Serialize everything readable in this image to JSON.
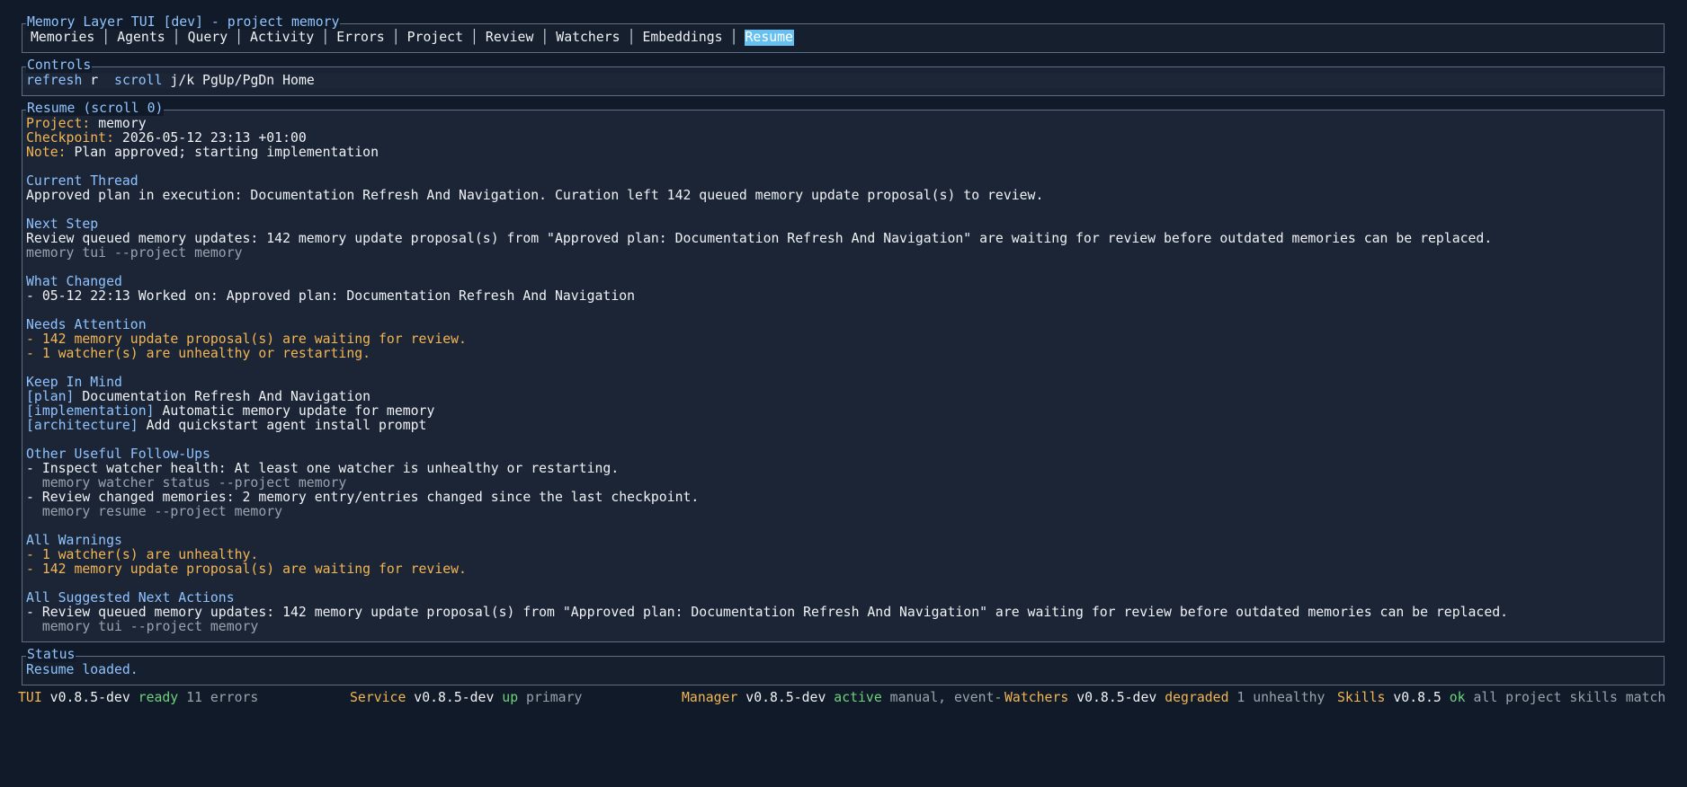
{
  "window": {
    "title": "Memory Layer TUI [dev] - project memory"
  },
  "tabs": [
    {
      "label": "Memories",
      "active": false
    },
    {
      "label": "Agents",
      "active": false
    },
    {
      "label": "Query",
      "active": false
    },
    {
      "label": "Activity",
      "active": false
    },
    {
      "label": "Errors",
      "active": false
    },
    {
      "label": "Project",
      "active": false
    },
    {
      "label": "Review",
      "active": false
    },
    {
      "label": "Watchers",
      "active": false
    },
    {
      "label": "Embeddings",
      "active": false
    },
    {
      "label": "Resume",
      "active": true
    }
  ],
  "controls": {
    "title": "Controls",
    "refresh_label": "refresh",
    "refresh_key": "r",
    "scroll_label": "scroll",
    "scroll_keys": "j/k PgUp/PgDn Home"
  },
  "resume": {
    "title": "Resume (scroll 0)",
    "project_label": "Project:",
    "project_value": "memory",
    "checkpoint_label": "Checkpoint:",
    "checkpoint_value": "2026-05-12 23:13 +01:00",
    "note_label": "Note:",
    "note_value": "Plan approved; starting implementation",
    "current_thread": {
      "heading": "Current Thread",
      "text": "Approved plan in execution: Documentation Refresh And Navigation. Curation left 142 queued memory update proposal(s) to review."
    },
    "next_step": {
      "heading": "Next Step",
      "text": "Review queued memory updates: 142 memory update proposal(s) from \"Approved plan: Documentation Refresh And Navigation\" are waiting for review before outdated memories can be replaced.",
      "command": "memory tui --project memory"
    },
    "what_changed": {
      "heading": "What Changed",
      "items": [
        "- 05-12 22:13 Worked on: Approved plan: Documentation Refresh And Navigation"
      ]
    },
    "needs_attention": {
      "heading": "Needs Attention",
      "items": [
        "- 142 memory update proposal(s) are waiting for review.",
        "- 1 watcher(s) are unhealthy or restarting."
      ]
    },
    "keep_in_mind": {
      "heading": "Keep In Mind",
      "items": [
        {
          "tag": "[plan]",
          "text": "Documentation Refresh And Navigation"
        },
        {
          "tag": "[implementation]",
          "text": "Automatic memory update for memory"
        },
        {
          "tag": "[architecture]",
          "text": "Add quickstart agent install prompt"
        }
      ]
    },
    "follow_ups": {
      "heading": "Other Useful Follow-Ups",
      "items": [
        {
          "text": "- Inspect watcher health: At least one watcher is unhealthy or restarting.",
          "command": "  memory watcher status --project memory"
        },
        {
          "text": "- Review changed memories: 2 memory entry/entries changed since the last checkpoint.",
          "command": "  memory resume --project memory"
        }
      ]
    },
    "all_warnings": {
      "heading": "All Warnings",
      "items": [
        "- 1 watcher(s) are unhealthy.",
        "- 142 memory update proposal(s) are waiting for review."
      ]
    },
    "suggested_actions": {
      "heading": "All Suggested Next Actions",
      "items": [
        {
          "text": "- Review queued memory updates: 142 memory update proposal(s) from \"Approved plan: Documentation Refresh And Navigation\" are waiting for review before outdated memories can be replaced.",
          "command": "  memory tui --project memory"
        }
      ]
    }
  },
  "status": {
    "title": "Status",
    "message": "Resume loaded."
  },
  "footer": {
    "tui": {
      "label": "TUI",
      "version": "v0.8.5-dev",
      "state": "ready",
      "detail": "11 errors"
    },
    "service": {
      "label": "Service",
      "version": "v0.8.5-dev",
      "state": "up",
      "detail": "primary"
    },
    "manager": {
      "label": "Manager",
      "version": "v0.8.5-dev",
      "state": "active",
      "detail": "manual, event-"
    },
    "watchers": {
      "label": "Watchers",
      "version": "v0.8.5-dev",
      "state": "degraded",
      "detail": "1 unhealthy"
    },
    "skills": {
      "label": "Skills",
      "version": "v0.8.5",
      "state": "ok",
      "detail": "all project skills match"
    }
  },
  "colors": {
    "background": "#111a28",
    "accent_blue": "#8fc3ff",
    "warning_orange": "#f3b653",
    "ok_green": "#6fd37c",
    "active_tab": "#66c1f2"
  }
}
